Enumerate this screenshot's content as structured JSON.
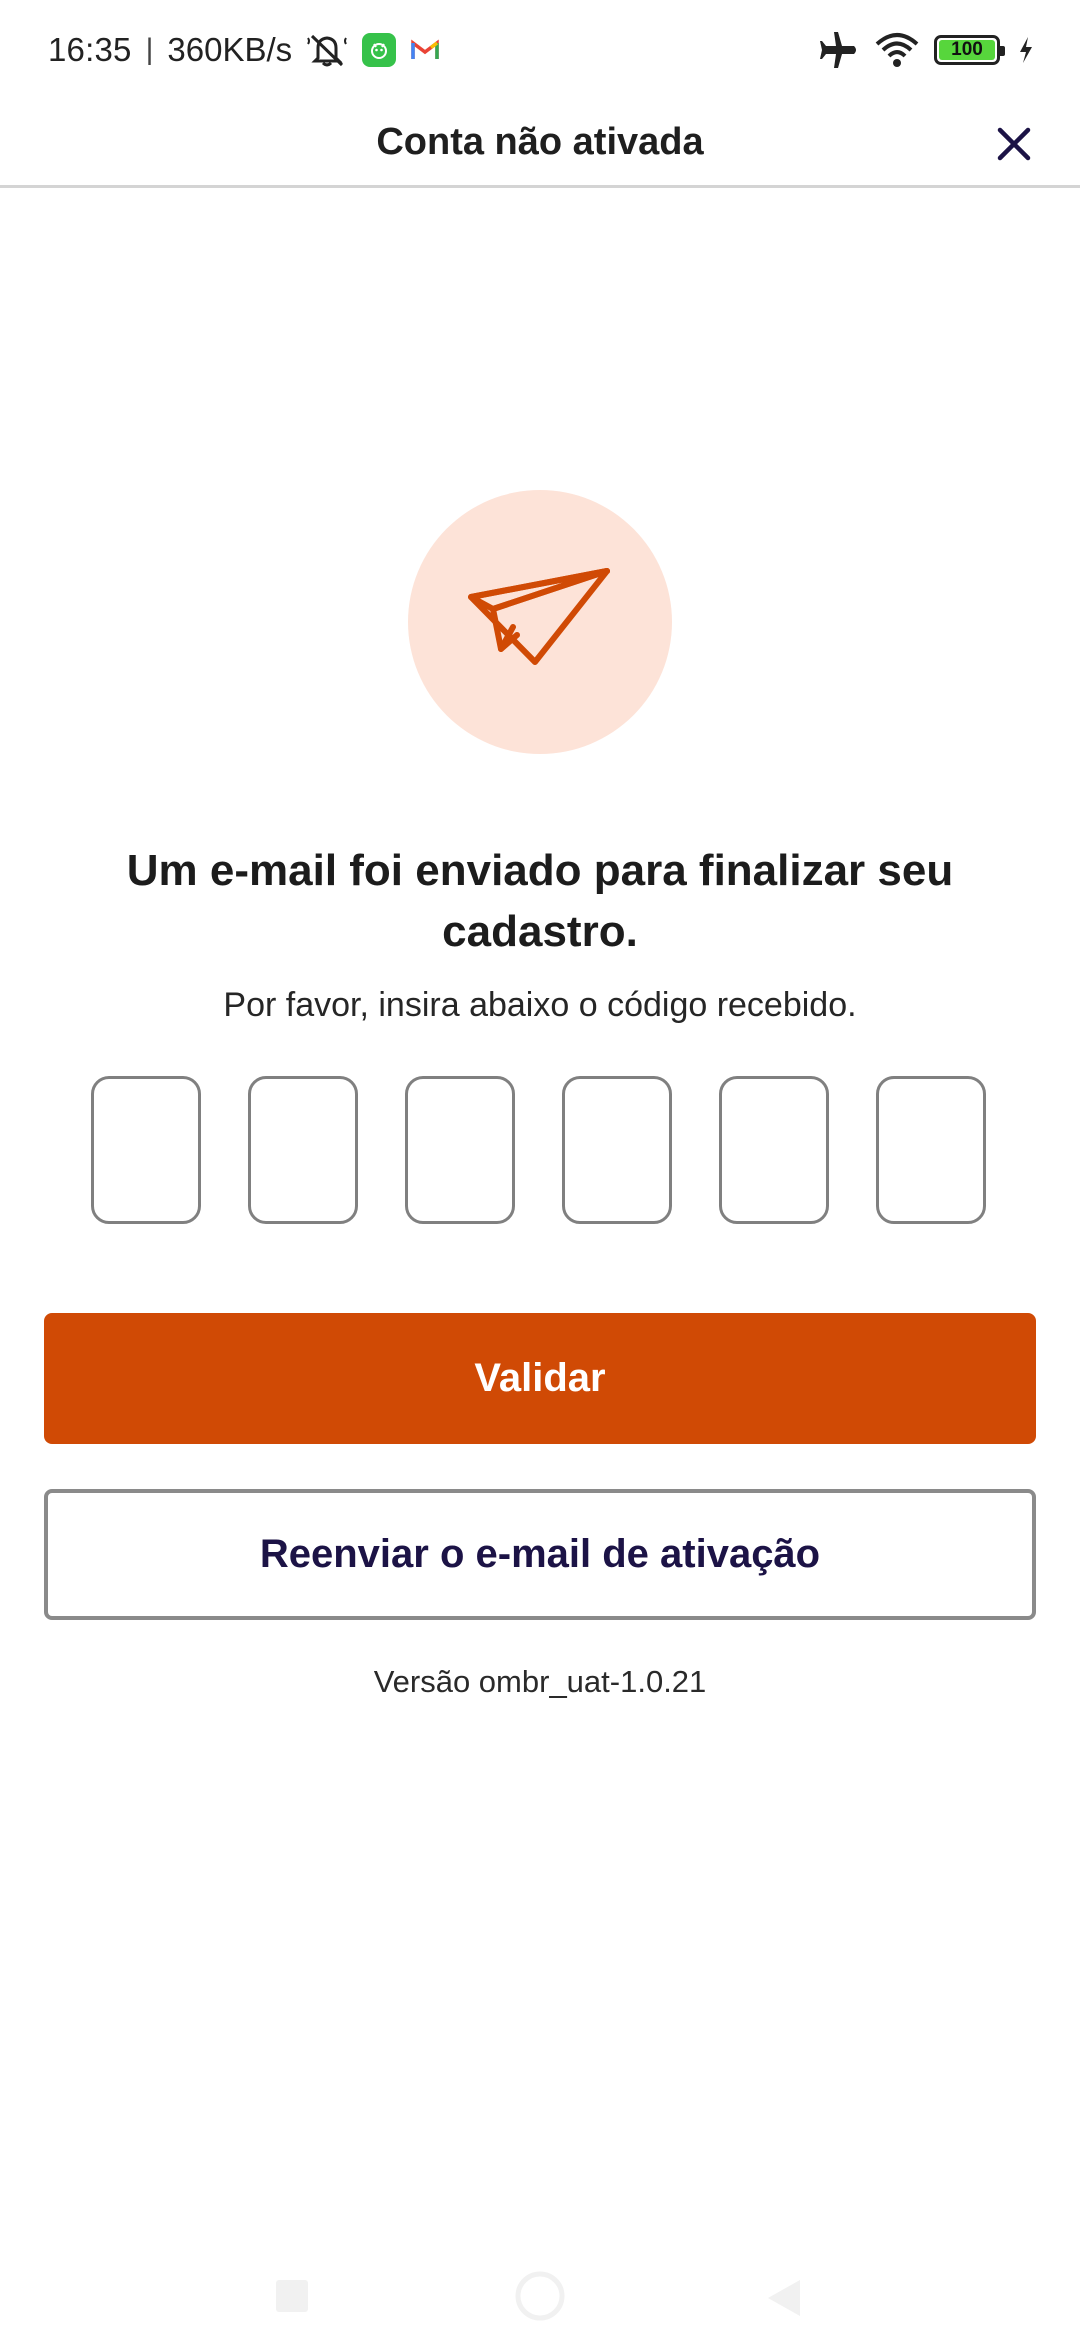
{
  "status_bar": {
    "time": "16:35",
    "separator": "|",
    "network_speed": "360KB/s",
    "battery_level": "100",
    "icons": [
      "mute-icon",
      "app-notification-icon",
      "gmail-icon",
      "airplane-mode-icon",
      "wifi-icon",
      "battery-icon",
      "charging-icon"
    ]
  },
  "header": {
    "title": "Conta não ativada",
    "close_icon": "close-icon"
  },
  "hero": {
    "icon": "paper-plane-icon",
    "circle_color": "#fde3d8",
    "icon_color": "#d04a05"
  },
  "main": {
    "headline": "Um e-mail foi enviado para finalizar seu cadastro.",
    "subtitle": "Por favor, insira abaixo o código recebido.",
    "code_inputs": [
      {
        "value": ""
      },
      {
        "value": ""
      },
      {
        "value": ""
      },
      {
        "value": ""
      },
      {
        "value": ""
      },
      {
        "value": ""
      }
    ],
    "validate_label": "Validar",
    "resend_label": "Reenviar o e-mail de ativação",
    "version_text": "Versão ombr_uat-1.0.21"
  },
  "colors": {
    "primary": "#d04a05",
    "secondary_text": "#1c1346",
    "border": "#808080"
  },
  "nav_bar": {
    "icons": [
      "recent-apps-icon",
      "home-icon",
      "back-icon"
    ]
  }
}
